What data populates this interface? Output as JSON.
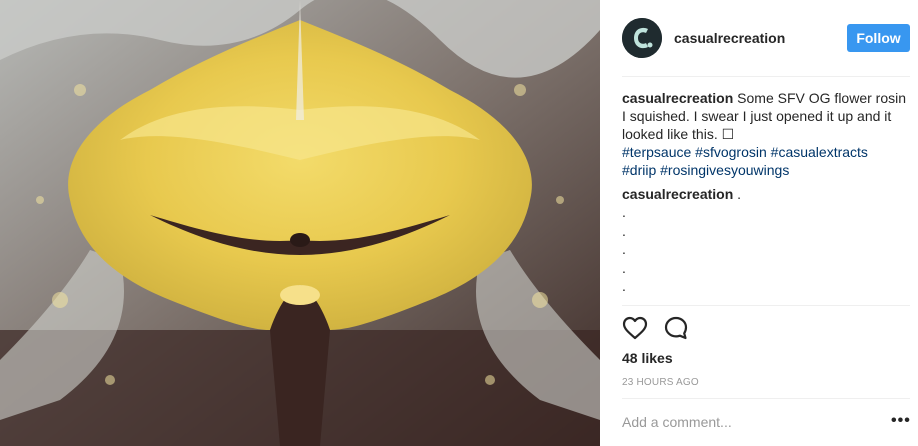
{
  "post": {
    "image_alt": "",
    "header": {
      "username": "casualrecreation",
      "follow_label": "Follow"
    },
    "caption": {
      "username": "casualrecreation",
      "text": " Some SFV OG flower rosin I squished. I swear I just opened it up and it looked like this. ",
      "emoji_box": "☐",
      "hashtags": [
        "#terpsauce",
        "#sfvogrosin",
        "#casualextracts",
        "#driip",
        "#rosingivesyouwings"
      ]
    },
    "comment": {
      "username": "casualrecreation",
      "text": " .",
      "dots": [
        ".",
        ".",
        ".",
        ".",
        "."
      ]
    },
    "actions": {
      "like_icon": "heart-outline-icon",
      "comment_icon": "speech-bubble-icon"
    },
    "likes": "48 likes",
    "timestamp": "23 HOURS AGO",
    "add_comment_placeholder": "Add a comment...",
    "more_label": "•••"
  },
  "colors": {
    "follow_button": "#3897f0",
    "hashtag": "#003569",
    "muted": "#999999",
    "text": "#262626"
  }
}
